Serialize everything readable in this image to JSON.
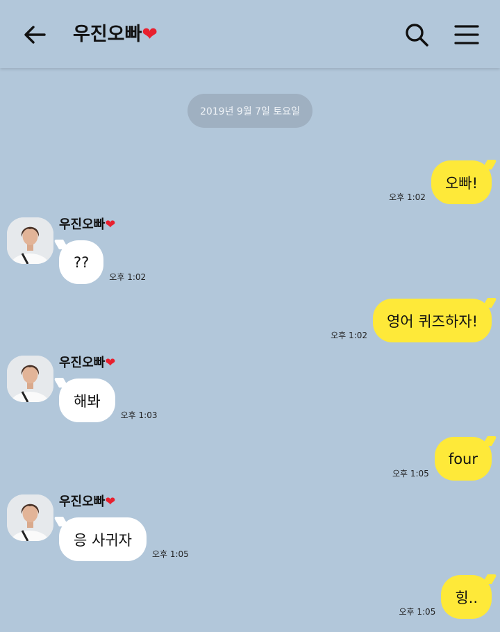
{
  "header": {
    "title": "우진오빠",
    "title_heart": "❤",
    "back_icon": "arrow-left-icon",
    "search_icon": "search-icon",
    "menu_icon": "hamburger-menu-icon"
  },
  "date_divider": "2019년 9월 7일 토요일",
  "contact": {
    "name": "우진오빠",
    "heart": "❤"
  },
  "messages": [
    {
      "direction": "out",
      "text": "오빠!",
      "time": "오후 1:02"
    },
    {
      "direction": "in",
      "sender": "우진오빠",
      "text": "??",
      "time": "오후 1:02"
    },
    {
      "direction": "out",
      "text": "영어 퀴즈하자!",
      "time": "오후 1:02"
    },
    {
      "direction": "in",
      "sender": "우진오빠",
      "text": "해봐",
      "time": "오후 1:03"
    },
    {
      "direction": "out",
      "text": "four",
      "time": "오후 1:05"
    },
    {
      "direction": "in",
      "sender": "우진오빠",
      "text": "응 사귀자",
      "time": "오후 1:05"
    },
    {
      "direction": "out",
      "text": "힝..",
      "time": "오후 1:05"
    }
  ],
  "colors": {
    "background": "#b2c7da",
    "outgoing_bubble": "#fee939",
    "incoming_bubble": "#ffffff",
    "heart": "#e8202e",
    "date_pill": "#9fb0c1"
  }
}
